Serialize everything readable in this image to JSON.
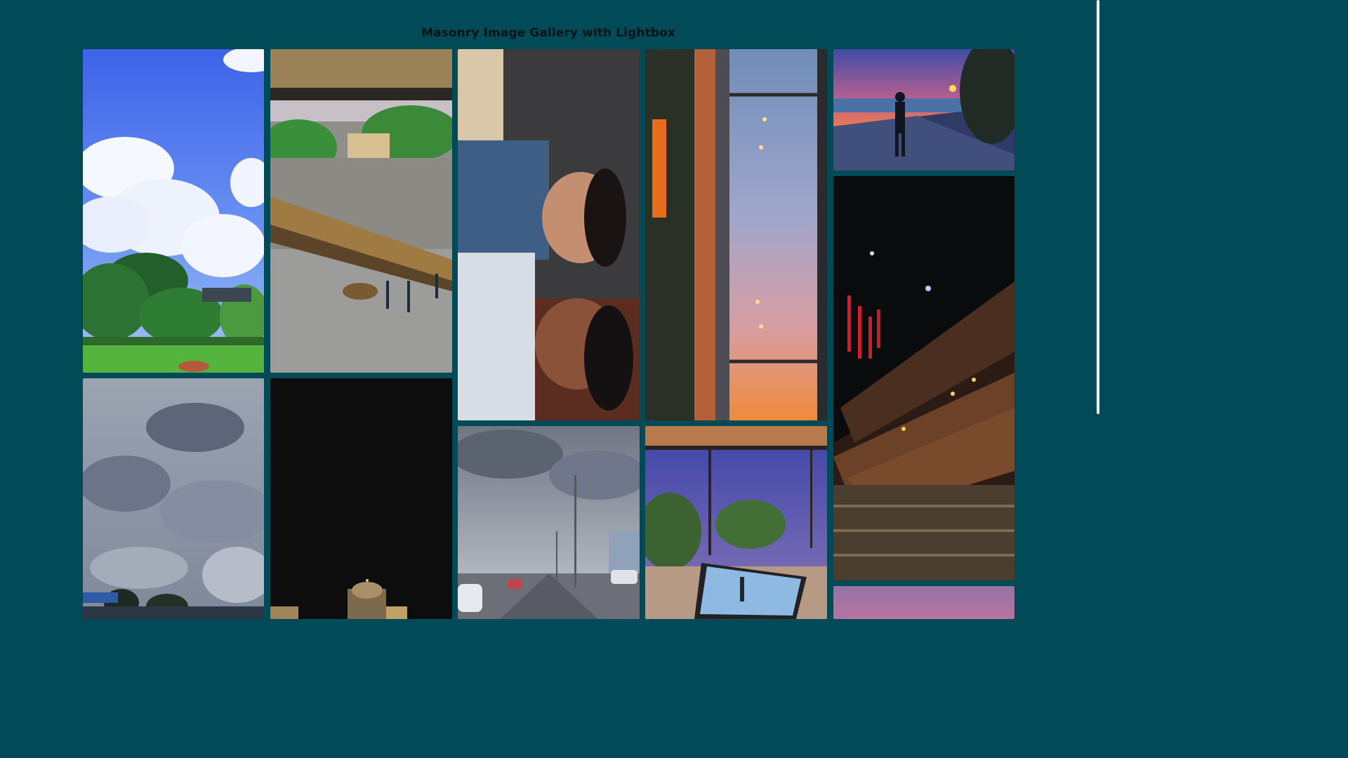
{
  "header": {
    "title": "Masonry Image Gallery with Lightbox"
  },
  "gallery": {
    "items": [
      {
        "icon": "photo-sky-trees"
      },
      {
        "icon": "photo-airplane-courtyard"
      },
      {
        "icon": "photo-selfie-two-people"
      },
      {
        "icon": "photo-sunset-lights-rotated"
      },
      {
        "icon": "photo-silhouette-sunset-walk"
      },
      {
        "icon": "photo-cloudy-sky-crowd"
      },
      {
        "icon": "photo-night-dome-building"
      },
      {
        "icon": "photo-highway-cloudy"
      },
      {
        "icon": "photo-rooftop-laptop-evening"
      },
      {
        "icon": "photo-cinema-recliners"
      },
      {
        "icon": "photo-purple-sky-partial"
      }
    ]
  },
  "colors": {
    "background": "#004b57",
    "title_text": "#041419",
    "scrollbar_thumb": "#f3f6f8"
  }
}
